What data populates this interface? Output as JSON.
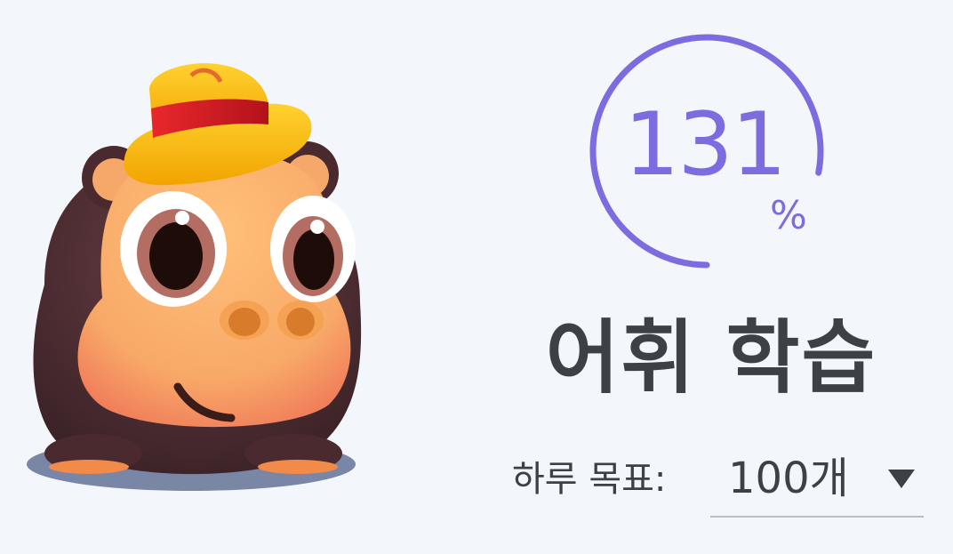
{
  "mascot": {
    "icon": "hippo-mascot-icon"
  },
  "progress": {
    "percent": 131,
    "value": "131",
    "unit": "%",
    "ring_fill_fraction": 0.78,
    "color": "#7d6be0"
  },
  "title": "어휘 학습",
  "daily_goal": {
    "label": "하루 목표:",
    "selected": "100개",
    "icon": "caret-down-icon"
  },
  "colors": {
    "background": "#f3f6fa",
    "text": "#3d4145",
    "accent": "#7d6be0"
  }
}
